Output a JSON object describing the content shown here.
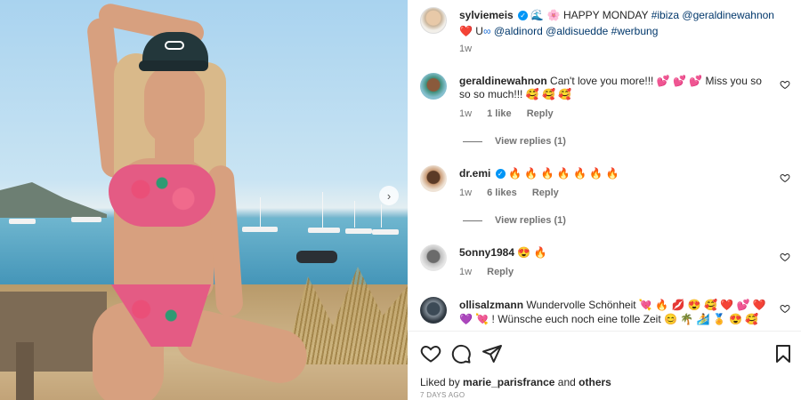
{
  "post": {
    "author": "sylviemeis",
    "caption_emoji": "🌊 🌸",
    "caption_text": "HAPPY MONDAY",
    "caption_tag1": "#ibiza",
    "caption_mention1": "@geraldinewahnon",
    "caption_line2_emoji": "❤️ U",
    "caption_line2_infinity": "∞",
    "caption_mention2": "@aldinord",
    "caption_mention3": "@aldisuedde",
    "caption_tag2": "#werbung",
    "time": "1w"
  },
  "comments": [
    {
      "username": "geraldinewahnon",
      "text_line1": "Can't love you more!!! 💕 💕 💕 Miss you so",
      "text_line2": "so so much!!! 🥰 🥰 🥰",
      "time": "1w",
      "likes": "1 like",
      "reply": "Reply",
      "view_replies": "View replies (1)"
    },
    {
      "username": "dr.emi",
      "text": "🔥 🔥 🔥 🔥 🔥 🔥 🔥",
      "time": "1w",
      "likes": "6 likes",
      "reply": "Reply",
      "view_replies": "View replies (1)"
    },
    {
      "username": "5onny1984",
      "text": "😍 🔥",
      "time": "1w",
      "reply": "Reply"
    },
    {
      "username": "ollisalzmann",
      "text_line1": "Wundervolle Schönheit 💘 🔥 💋 😍 🥰 ❤️ 💕 ❤️",
      "text_line2": "💜 💘 ! Wünsche euch noch eine tolle Zeit 😊 🌴 🏄 🏅 😍 🥰"
    }
  ],
  "footer": {
    "liked_by_prefix": "Liked by",
    "liked_by_user": "marie_parisfrance",
    "liked_by_and": "and",
    "liked_by_others": "others",
    "date": "7 DAYS AGO"
  },
  "icons": {
    "like": "heart-icon",
    "comment": "comment-icon",
    "share": "send-icon",
    "save": "bookmark-icon",
    "next": "chevron-right-icon"
  },
  "colors": {
    "link": "#00376b",
    "verified": "#0095f6",
    "muted": "#737373"
  }
}
